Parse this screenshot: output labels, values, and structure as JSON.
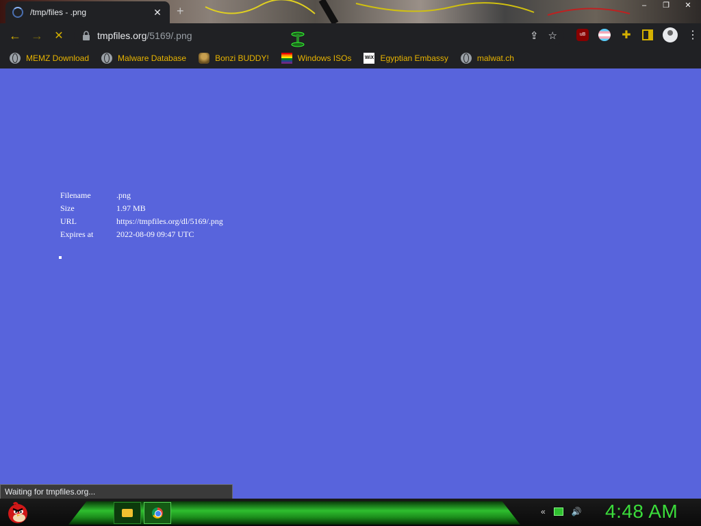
{
  "tab": {
    "title": "/tmp/files - .png",
    "close_glyph": "✕",
    "new_tab_glyph": "+"
  },
  "window_controls": [
    "–",
    "❐",
    "✕"
  ],
  "toolbar": {
    "back_glyph": "←",
    "forward_glyph": "→",
    "stop_glyph": "✕",
    "url_host": "tmpfiles.org",
    "url_path": "/5169/.png",
    "share_glyph": "⇪",
    "star_glyph": "☆"
  },
  "extensions": {
    "ublock_label": "uB",
    "puzzle_glyph": "✚",
    "menu_glyph": "⋮"
  },
  "bookmarks": [
    {
      "label": "MEMZ Download",
      "icon": "globe-icon"
    },
    {
      "label": "Malware Database",
      "icon": "globe-icon"
    },
    {
      "label": "Bonzi BUDDY!",
      "icon": "bonzi-icon"
    },
    {
      "label": "Windows ISOs",
      "icon": "rainbow-flag-icon"
    },
    {
      "label": "Egyptian Embassy",
      "icon": "wix-icon",
      "icon_text": "WiX"
    },
    {
      "label": "malwat.ch",
      "icon": "globe-icon"
    }
  ],
  "file_info": {
    "rows": [
      {
        "key": "Filename",
        "value": ".png"
      },
      {
        "key": "Size",
        "value": "1.97 MB"
      },
      {
        "key": "URL",
        "value": "https://tmpfiles.org/dl/5169/.png"
      },
      {
        "key": "Expires at",
        "value": "2022-08-09 09:47 UTC"
      }
    ]
  },
  "status_bar": "Waiting for tmpfiles.org...",
  "taskbar": {
    "clock": "4:48 AM"
  },
  "colors": {
    "page_background": "#5864dc",
    "bookmark_text": "#e8b400",
    "clock_text": "#3bdc3b"
  }
}
